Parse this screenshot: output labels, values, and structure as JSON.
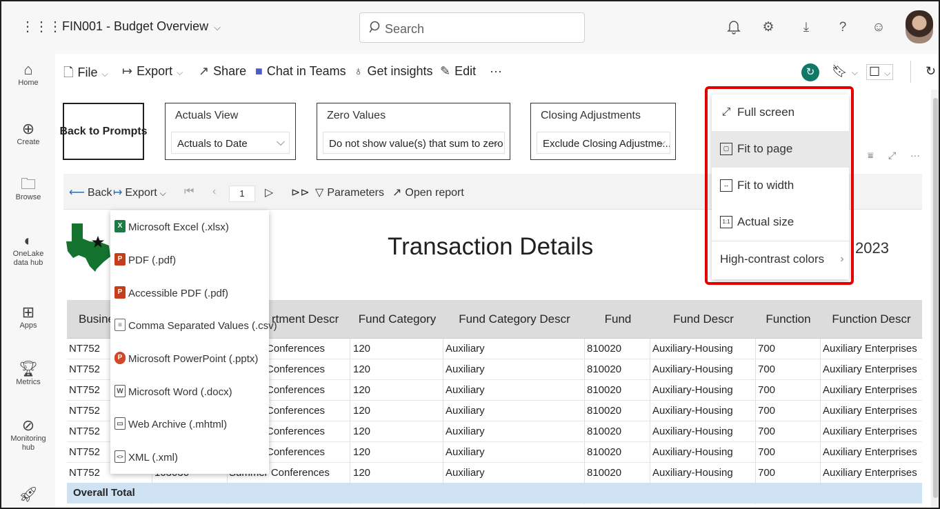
{
  "app": {
    "title": "FIN001 - Budget Overview",
    "search_placeholder": "Search"
  },
  "rail": {
    "items": [
      {
        "label": "Home",
        "icon": "home-icon"
      },
      {
        "label": "Create",
        "icon": "plus-circle-icon"
      },
      {
        "label": "Browse",
        "icon": "folder-icon"
      },
      {
        "label": "OneLake data hub",
        "icon": "onelake-icon"
      },
      {
        "label": "Apps",
        "icon": "apps-icon"
      },
      {
        "label": "Metrics",
        "icon": "trophy-icon"
      },
      {
        "label": "Monitoring hub",
        "icon": "monitor-icon"
      }
    ]
  },
  "toolbar": {
    "file": "File",
    "export": "Export",
    "share": "Share",
    "chat_in_teams": "Chat in Teams",
    "get_insights": "Get insights",
    "edit": "Edit",
    "more": "···"
  },
  "prompts": {
    "back_to_prompts": "Back to Prompts",
    "actuals_view": {
      "label": "Actuals View",
      "value": "Actuals to Date"
    },
    "zero_values": {
      "label": "Zero Values",
      "value": "Do not show value(s) that sum to zero"
    },
    "closing_adjustments": {
      "label": "Closing Adjustments",
      "value": "Exclude Closing Adjustme..."
    }
  },
  "report_bar": {
    "back": "Back",
    "export": "Export",
    "page": "1",
    "parameters": "Parameters",
    "open_report": "Open report"
  },
  "report": {
    "title": "Transaction Details",
    "year_fragment": "2023"
  },
  "table": {
    "headers": [
      "Busines",
      "rtment Descr",
      "Fund Category",
      "Fund Category Descr",
      "Fund",
      "Fund Descr",
      "Function",
      "Function Descr"
    ],
    "rows": [
      [
        "NT752",
        "Conferences",
        "120",
        "Auxiliary",
        "810020",
        "Auxiliary-Housing",
        "700",
        "Auxiliary Enterprises"
      ],
      [
        "NT752",
        "Conferences",
        "120",
        "Auxiliary",
        "810020",
        "Auxiliary-Housing",
        "700",
        "Auxiliary Enterprises"
      ],
      [
        "NT752",
        "Conferences",
        "120",
        "Auxiliary",
        "810020",
        "Auxiliary-Housing",
        "700",
        "Auxiliary Enterprises"
      ],
      [
        "NT752",
        "Conferences",
        "120",
        "Auxiliary",
        "810020",
        "Auxiliary-Housing",
        "700",
        "Auxiliary Enterprises"
      ],
      [
        "NT752",
        "Conferences",
        "120",
        "Auxiliary",
        "810020",
        "Auxiliary-Housing",
        "700",
        "Auxiliary Enterprises"
      ],
      [
        "NT752",
        "Conferences",
        "120",
        "Auxiliary",
        "810020",
        "Auxiliary-Housing",
        "700",
        "Auxiliary Enterprises"
      ],
      [
        "NT752",
        "Summer Conferences",
        "120",
        "Auxiliary",
        "810020",
        "Auxiliary-Housing",
        "700",
        "Auxiliary Enterprises"
      ]
    ],
    "last_row_partial_id": "103030",
    "total_label": "Overall Total"
  },
  "export_menu": {
    "items": [
      {
        "label": "Microsoft Excel (.xlsx)",
        "icon": "excel-icon",
        "color": "#1d7a45"
      },
      {
        "label": "PDF (.pdf)",
        "icon": "pdf-icon",
        "color": "#c43e1c"
      },
      {
        "label": "Accessible PDF (.pdf)",
        "icon": "accessible-pdf-icon",
        "color": "#c43e1c"
      },
      {
        "label": "Comma Separated Values (.csv)",
        "icon": "csv-icon",
        "color": "#666666"
      },
      {
        "label": "Microsoft PowerPoint (.pptx)",
        "icon": "powerpoint-icon",
        "color": "#d24726"
      },
      {
        "label": "Microsoft Word (.docx)",
        "icon": "word-icon",
        "color": "#555555"
      },
      {
        "label": "Web Archive (.mhtml)",
        "icon": "web-archive-icon",
        "color": "#555555"
      },
      {
        "label": "XML (.xml)",
        "icon": "xml-icon",
        "color": "#555555"
      }
    ]
  },
  "view_menu": {
    "items": [
      {
        "label": "Full screen",
        "icon": "full-screen-icon"
      },
      {
        "label": "Fit to page",
        "icon": "fit-to-page-icon"
      },
      {
        "label": "Fit to width",
        "icon": "fit-to-width-icon"
      },
      {
        "label": "Actual size",
        "icon": "actual-size-icon"
      },
      {
        "label": "High-contrast colors",
        "icon": "chevron-right-icon"
      }
    ]
  },
  "colors": {
    "accent_green": "#117865",
    "highlight_red": "#e30000",
    "total_row": "#cfe2f3",
    "header_row": "#dcdcdc"
  }
}
